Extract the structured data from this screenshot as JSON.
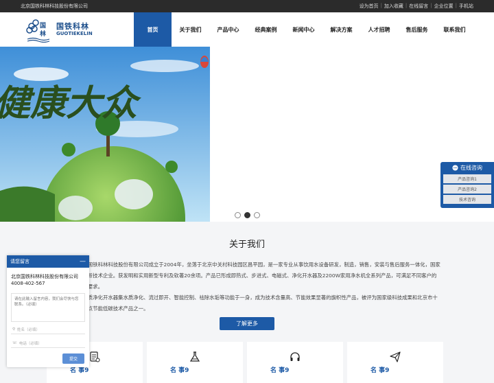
{
  "topbar": {
    "company": "北京国铁科林科技股份有限公司",
    "links": [
      "设为首页",
      "加入收藏",
      "在线留言",
      "企业位置",
      "手机站"
    ]
  },
  "logo": {
    "name_cn": "国铁科林",
    "name_en": "GUOTIEKELIN"
  },
  "nav": {
    "items": [
      "首页",
      "关于我们",
      "产品中心",
      "经典案例",
      "新闻中心",
      "解决方案",
      "人才招聘",
      "售后服务",
      "联系我们"
    ],
    "active_index": 0
  },
  "banner": {
    "slide_text": "健康大众",
    "current_slide": 2,
    "total_slides": 3
  },
  "about": {
    "title": "关于我们",
    "paragraphs": [
      "北京国铁科林科技股份有限公司成立于2004年，坐落于北京中关村科技园区昌平园，是一家专业从事饮用水设备研发，制造，销售，安装与售后服务一体化，国家级高新技术企业。获发明和实用新型专利及软著20余项。产品已形成即热式、步进式、电磁式、净化开水器及2200W家用净水机全系列产品，可满足不同客户的各种要求。",
      "集水质净化开水器集水质净化、流过即开、智能控制、祛除水垢等功能于一身，成为技术含量高、节能效果显著的旗帜性产品，被评为国家级科技成果和北京市十大重点节能低碳技术产品之一。"
    ],
    "more_label": "了解更多"
  },
  "cards": [
    {
      "icon": "document-list-icon",
      "label": "名 事9"
    },
    {
      "icon": "flask-icon",
      "label": "名 事9"
    },
    {
      "icon": "headphones-icon",
      "label": "名 事9"
    },
    {
      "icon": "paper-plane-icon",
      "label": "名 事9"
    }
  ],
  "chat": {
    "title": "在线咨询",
    "buttons": [
      "产品咨询1",
      "产品咨询2",
      "技术咨询"
    ]
  },
  "message": {
    "title": "请您留言",
    "company": "北京国铁科林科技股份有限公司",
    "phone": "4008-402-567",
    "content_placeholder": "请在此输入留言内容，我们会尽快与您联系。（必填）",
    "name_placeholder": "姓名（必填）",
    "phone_placeholder": "电话（必填）",
    "submit_label": "提交"
  },
  "colors": {
    "brand_blue": "#1d5aa6",
    "topbar_bg": "#2b2b2b"
  }
}
